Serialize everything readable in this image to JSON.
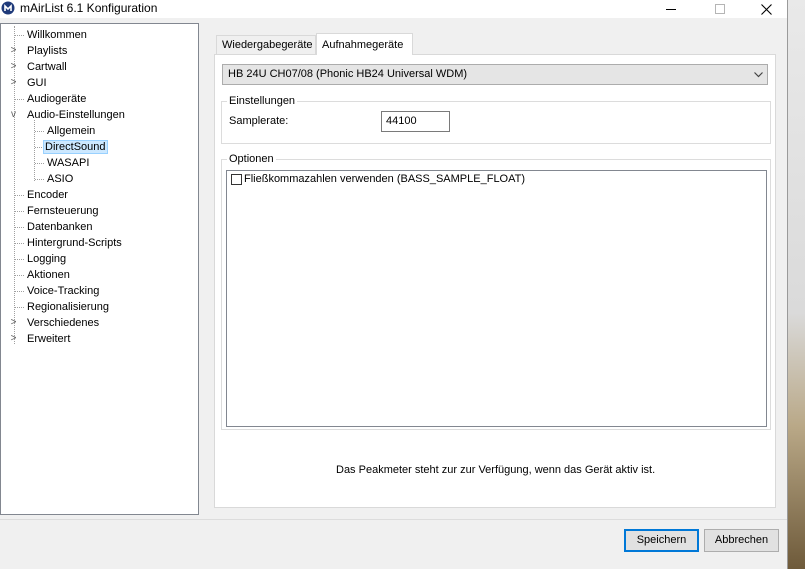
{
  "window": {
    "title": "mAirList 6.1 Konfiguration",
    "minimize_icon": "minimize-icon",
    "maximize_icon": "maximize-icon",
    "close_icon": "close-icon"
  },
  "tree": {
    "items": [
      {
        "label": "Willkommen",
        "expander": ""
      },
      {
        "label": "Playlists",
        "expander": ">"
      },
      {
        "label": "Cartwall",
        "expander": ">"
      },
      {
        "label": "GUI",
        "expander": ">"
      },
      {
        "label": "Audiogeräte",
        "expander": ""
      },
      {
        "label": "Audio-Einstellungen",
        "expander": "v"
      },
      {
        "label": "Allgemein",
        "expander": ""
      },
      {
        "label": "DirectSound",
        "expander": "",
        "selected": true
      },
      {
        "label": "WASAPI",
        "expander": ""
      },
      {
        "label": "ASIO",
        "expander": ""
      },
      {
        "label": "Encoder",
        "expander": ""
      },
      {
        "label": "Fernsteuerung",
        "expander": ""
      },
      {
        "label": "Datenbanken",
        "expander": ""
      },
      {
        "label": "Hintergrund-Scripts",
        "expander": ""
      },
      {
        "label": "Logging",
        "expander": ""
      },
      {
        "label": "Aktionen",
        "expander": ""
      },
      {
        "label": "Voice-Tracking",
        "expander": ""
      },
      {
        "label": "Regionalisierung",
        "expander": ""
      },
      {
        "label": "Verschiedenes",
        "expander": ">"
      },
      {
        "label": "Erweitert",
        "expander": ">"
      }
    ]
  },
  "tabs": [
    {
      "label": "Wiedergabegeräte",
      "active": false
    },
    {
      "label": "Aufnahmegeräte",
      "active": true
    }
  ],
  "device": {
    "selected": "HB 24U CH07/08 (Phonic HB24 Universal WDM)"
  },
  "settings": {
    "legend": "Einstellungen",
    "samplerate_label": "Samplerate:",
    "samplerate_value": "44100"
  },
  "options": {
    "legend": "Optionen",
    "items": [
      {
        "label": "Fließkommazahlen verwenden (BASS_SAMPLE_FLOAT)",
        "checked": false
      }
    ]
  },
  "info_text": "Das Peakmeter steht zur zur Verfügung, wenn das Gerät aktiv ist.",
  "buttons": {
    "save": "Speichern",
    "cancel": "Abbrechen"
  },
  "colors": {
    "selection_bg": "#cce8ff",
    "accent": "#0078d7"
  }
}
